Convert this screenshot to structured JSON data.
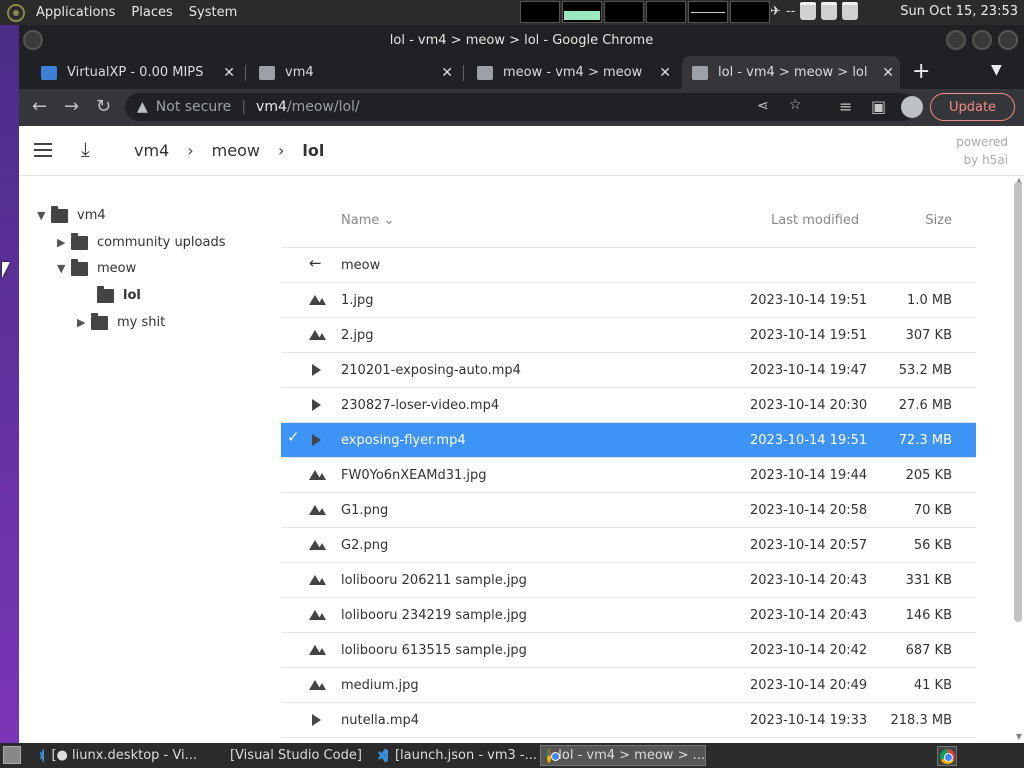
{
  "top_panel": {
    "menus": [
      "Applications",
      "Places",
      "System"
    ],
    "clock": "Sun Oct 15, 23:53",
    "tray_separator": "--"
  },
  "window": {
    "title": "lol - vm4 > meow > lol - Google Chrome",
    "tabs": [
      {
        "label": "VirtualXP - 0.00 MIPS",
        "icon": "vm-icon",
        "active": false
      },
      {
        "label": "vm4",
        "icon": "folder-icon",
        "active": false
      },
      {
        "label": "meow - vm4 > meow",
        "icon": "folder-icon",
        "active": false
      },
      {
        "label": "lol - vm4 > meow > lol",
        "icon": "folder-icon",
        "active": true
      }
    ],
    "new_tab": "+",
    "tab_close": "✕"
  },
  "toolbar": {
    "security_label": "Not secure",
    "url_host": "vm4",
    "url_path": "/meow/lol/",
    "update_label": "Update"
  },
  "page": {
    "breadcrumbs": [
      "vm4",
      "meow",
      "lol"
    ],
    "powered_by": [
      "powered",
      "by h5ai"
    ],
    "tree": [
      {
        "label": "vm4",
        "level": 0,
        "expanded": true
      },
      {
        "label": "community uploads",
        "level": 1,
        "expanded": false
      },
      {
        "label": "meow",
        "level": 1,
        "expanded": true
      },
      {
        "label": "lol",
        "level": 2,
        "current": true
      },
      {
        "label": "my shit",
        "level": 2,
        "expanded": false
      }
    ],
    "columns": {
      "name": "Name",
      "modified": "Last modified",
      "size": "Size"
    },
    "parent": "meow",
    "files": [
      {
        "name": "1.jpg",
        "modified": "2023-10-14 19:51",
        "size": "1.0 MB",
        "type": "image"
      },
      {
        "name": "2.jpg",
        "modified": "2023-10-14 19:51",
        "size": "307 KB",
        "type": "image"
      },
      {
        "name": "210201-exposing-auto.mp4",
        "modified": "2023-10-14 19:47",
        "size": "53.2 MB",
        "type": "video"
      },
      {
        "name": "230827-loser-video.mp4",
        "modified": "2023-10-14 20:30",
        "size": "27.6 MB",
        "type": "video"
      },
      {
        "name": "exposing-flyer.mp4",
        "modified": "2023-10-14 19:51",
        "size": "72.3 MB",
        "type": "video",
        "selected": true
      },
      {
        "name": "FW0Yo6nXEAMd31.jpg",
        "modified": "2023-10-14 19:44",
        "size": "205 KB",
        "type": "image"
      },
      {
        "name": "G1.png",
        "modified": "2023-10-14 20:58",
        "size": "70 KB",
        "type": "image"
      },
      {
        "name": "G2.png",
        "modified": "2023-10-14 20:57",
        "size": "56 KB",
        "type": "image"
      },
      {
        "name": "lolibooru 206211 sample.jpg",
        "modified": "2023-10-14 20:43",
        "size": "331 KB",
        "type": "image"
      },
      {
        "name": "lolibooru 234219 sample.jpg",
        "modified": "2023-10-14 20:43",
        "size": "146 KB",
        "type": "image"
      },
      {
        "name": "lolibooru 613515 sample.jpg",
        "modified": "2023-10-14 20:42",
        "size": "687 KB",
        "type": "image"
      },
      {
        "name": "medium.jpg",
        "modified": "2023-10-14 20:49",
        "size": "41 KB",
        "type": "image"
      },
      {
        "name": "nutella.mp4",
        "modified": "2023-10-14 19:33",
        "size": "218.3 MB",
        "type": "video"
      }
    ]
  },
  "taskbar": {
    "tasks": [
      {
        "label": "[● liunx.desktop - Vi...",
        "icon": "vscode-icon",
        "active": false
      },
      {
        "label": "[Visual Studio Code]",
        "icon": "none",
        "active": false
      },
      {
        "label": "[launch.json - vm3 -...",
        "icon": "vscode-icon",
        "active": false
      },
      {
        "label": "lol - vm4 > meow > ...",
        "icon": "chrome-icon",
        "active": true
      }
    ]
  },
  "colors": {
    "selection": "#3d94f6",
    "update_accent": "#f28b82"
  }
}
